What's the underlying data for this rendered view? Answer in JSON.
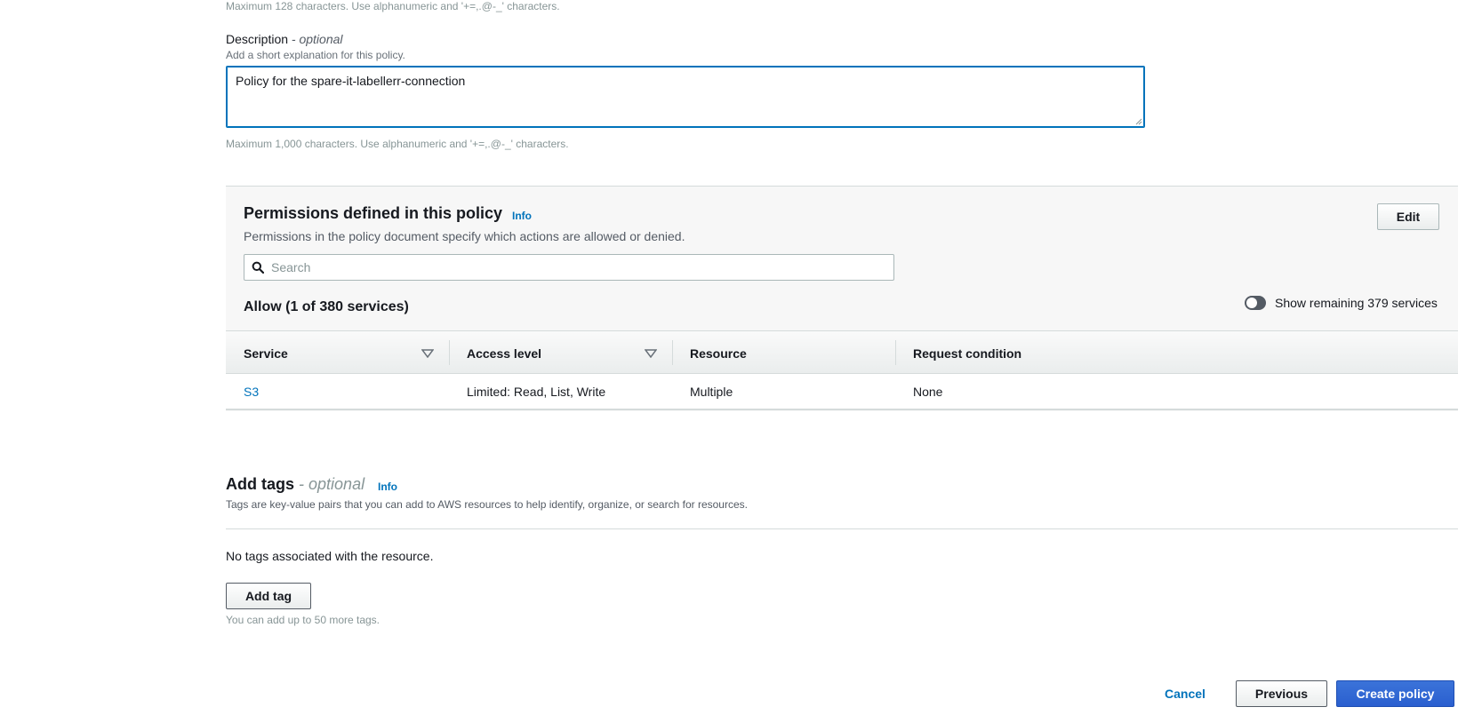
{
  "name_field": {
    "max_hint": "Maximum 128 characters. Use alphanumeric and '+=,.@-_' characters."
  },
  "description_field": {
    "label": "Description",
    "optional": "- optional",
    "sub": "Add a short explanation for this policy.",
    "value": "Policy for the spare-it-labellerr-connection",
    "max_hint": "Maximum 1,000 characters. Use alphanumeric and '+=,.@-_' characters."
  },
  "permissions": {
    "title": "Permissions defined in this policy",
    "info": "Info",
    "subtitle": "Permissions in the policy document specify which actions are allowed or denied.",
    "edit_label": "Edit",
    "search_placeholder": "Search",
    "allow_title": "Allow (1 of 380 services)",
    "toggle_label": "Show remaining 379 services",
    "toggle_on": false,
    "columns": [
      "Service",
      "Access level",
      "Resource",
      "Request condition"
    ],
    "rows": [
      {
        "service": "S3",
        "access_level": "Limited: Read, List, Write",
        "resource": "Multiple",
        "request_condition": "None"
      }
    ]
  },
  "tags": {
    "title": "Add tags",
    "optional": "- optional",
    "info": "Info",
    "subtitle": "Tags are key-value pairs that you can add to AWS resources to help identify, organize, or search for resources.",
    "empty": "No tags associated with the resource.",
    "add_label": "Add tag",
    "limit_hint": "You can add up to 50 more tags."
  },
  "footer": {
    "cancel_label": "Cancel",
    "previous_label": "Previous",
    "create_label": "Create policy"
  },
  "colors": {
    "link": "#0073bb",
    "primary_button": "#2a5fcf",
    "border": "#d5dbdb"
  },
  "icons": {
    "search": "search-icon",
    "sort": "sort-down-icon",
    "toggle": "toggle-switch"
  }
}
